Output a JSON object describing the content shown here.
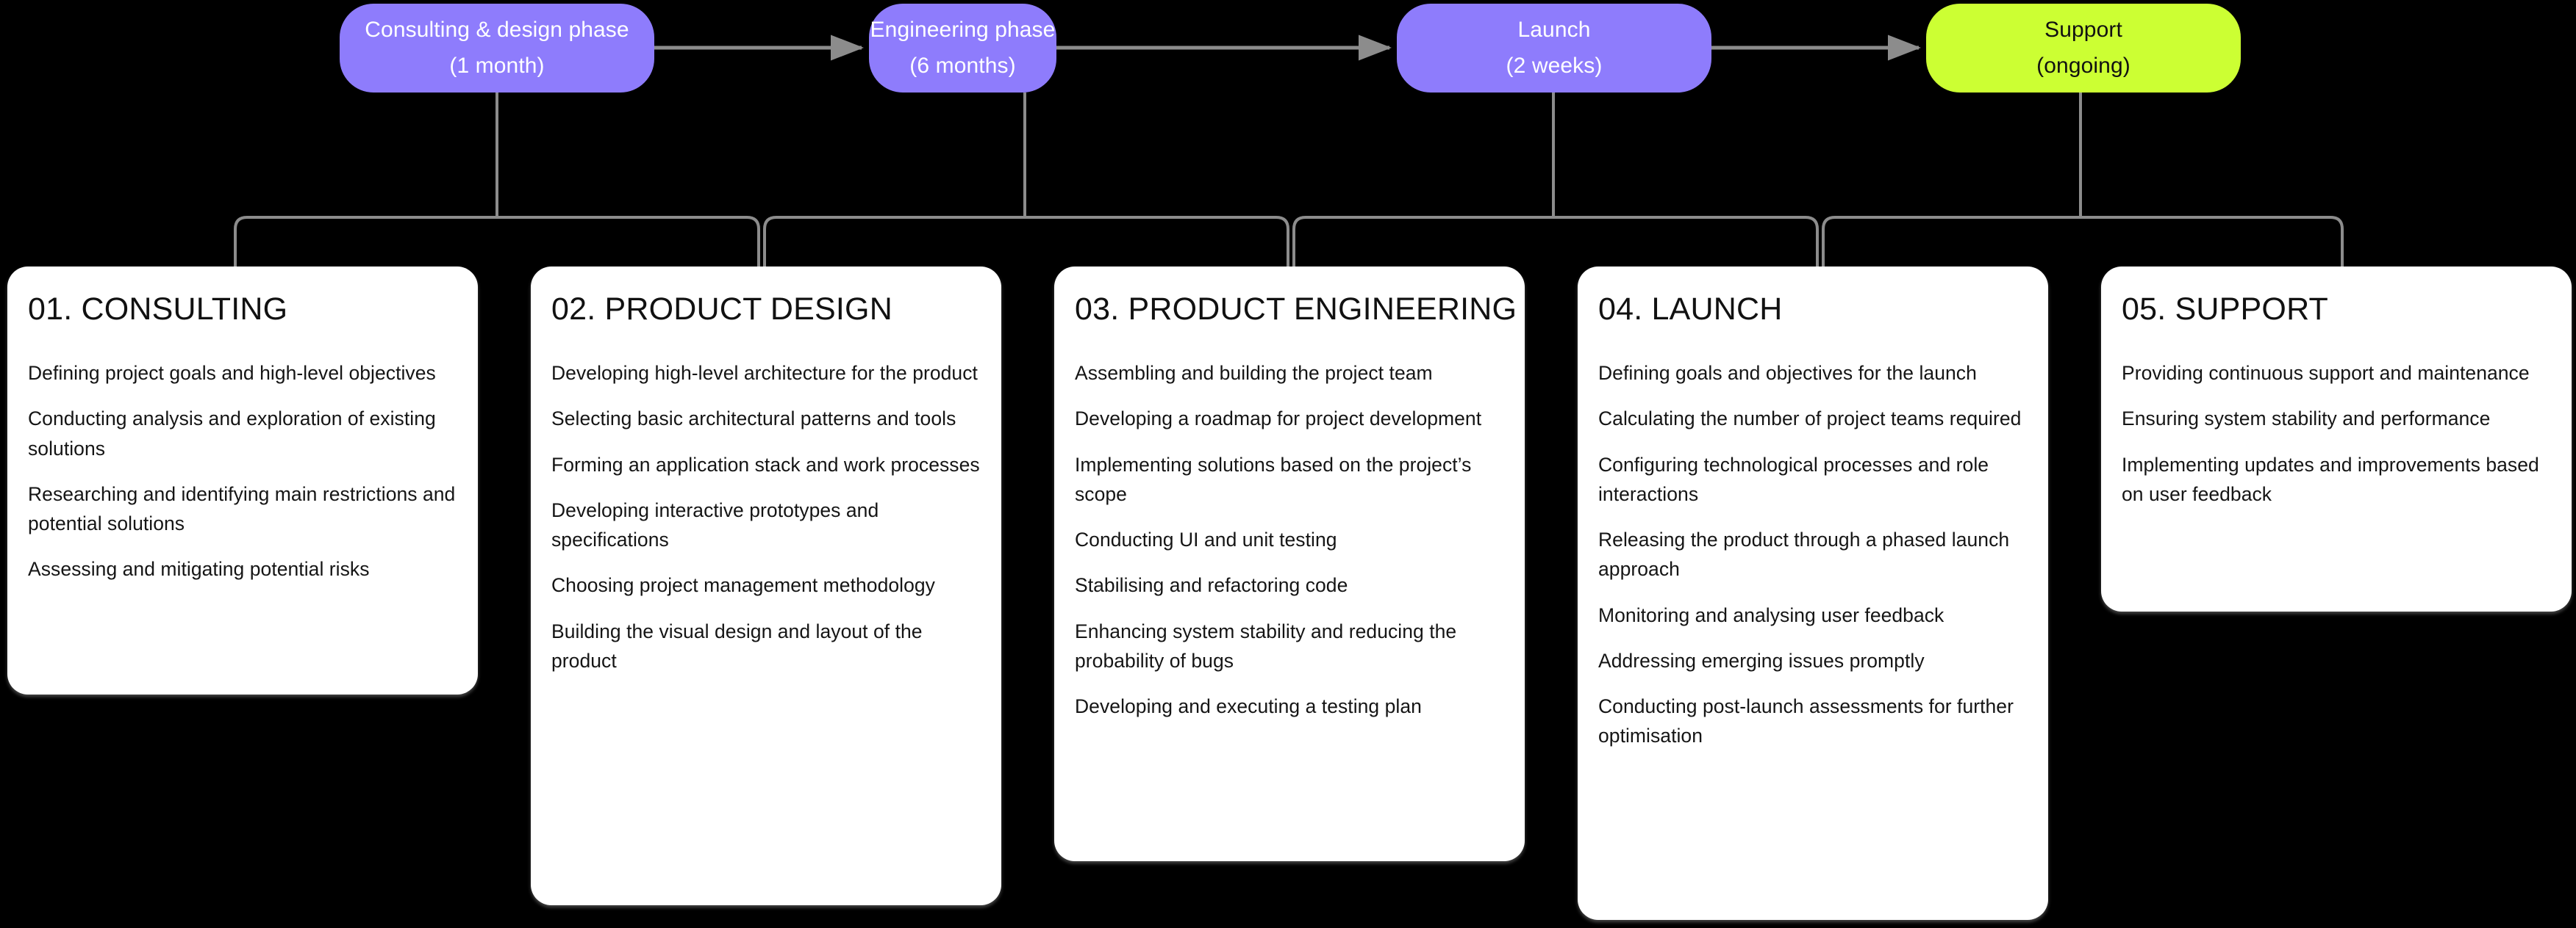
{
  "theme": {
    "background": "#000000",
    "phase_fill_primary": "#8e7cfc",
    "phase_fill_final": "#ccff33",
    "phase_text_primary": "#ffffff",
    "phase_text_final": "#111111",
    "connector_color": "#8c8c8c",
    "card_background": "#ffffff",
    "card_text": "#151515"
  },
  "timeline": {
    "phases": [
      {
        "title": "Consulting & design phase",
        "duration": "(1 month)"
      },
      {
        "title": "Engineering phase",
        "duration": "(6 months)"
      },
      {
        "title": "Launch",
        "duration": "(2 weeks)"
      },
      {
        "title": "Support",
        "duration": "(ongoing)"
      }
    ]
  },
  "cards": [
    {
      "heading": "01. CONSULTING",
      "items": [
        "Defining project goals and high-level objectives",
        "Conducting analysis and exploration of existing solutions",
        "Researching and identifying main restrictions and potential solutions",
        "Assessing and mitigating potential risks"
      ]
    },
    {
      "heading": "02. PRODUCT DESIGN",
      "items": [
        "Developing high-level architecture for the product",
        "Selecting basic architectural patterns and tools",
        "Forming an application stack and work processes",
        "Developing interactive prototypes and specifications",
        "Choosing project management methodology",
        "Building the visual design and layout of the product"
      ]
    },
    {
      "heading": "03. PRODUCT ENGINEERING",
      "items": [
        "Assembling and building the project team",
        "Developing a roadmap for project development",
        "Implementing solutions based on the project’s scope",
        "Conducting UI and unit testing",
        "Stabilising and refactoring code",
        "Enhancing system stability and reducing the probability of bugs",
        "Developing and executing a testing plan"
      ]
    },
    {
      "heading": "04. LAUNCH",
      "items": [
        "Defining goals and objectives for the launch",
        "Calculating the number of project teams required",
        "Configuring technological processes and role interactions",
        "Releasing the product through a phased launch approach",
        "Monitoring and analysing user feedback",
        "Addressing emerging issues promptly",
        "Conducting post-launch assessments for further optimisation"
      ]
    },
    {
      "heading": "05. SUPPORT",
      "items": [
        "Providing continuous support and maintenance",
        "Ensuring system stability and performance",
        "Implementing updates and improvements based on user feedback"
      ]
    }
  ]
}
